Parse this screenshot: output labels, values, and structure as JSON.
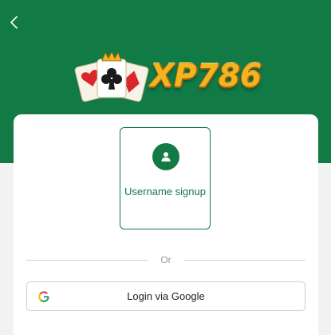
{
  "header": {
    "logo_text": "XP786",
    "brand_color": "#117a45",
    "logo_color": "#f2b51f"
  },
  "nav": {
    "back_icon": "chevron-left-icon"
  },
  "signup": {
    "icon": "user-icon",
    "label": "Username signup"
  },
  "divider": {
    "text": "Or"
  },
  "google": {
    "icon": "google-icon",
    "label": "Login via Google"
  }
}
